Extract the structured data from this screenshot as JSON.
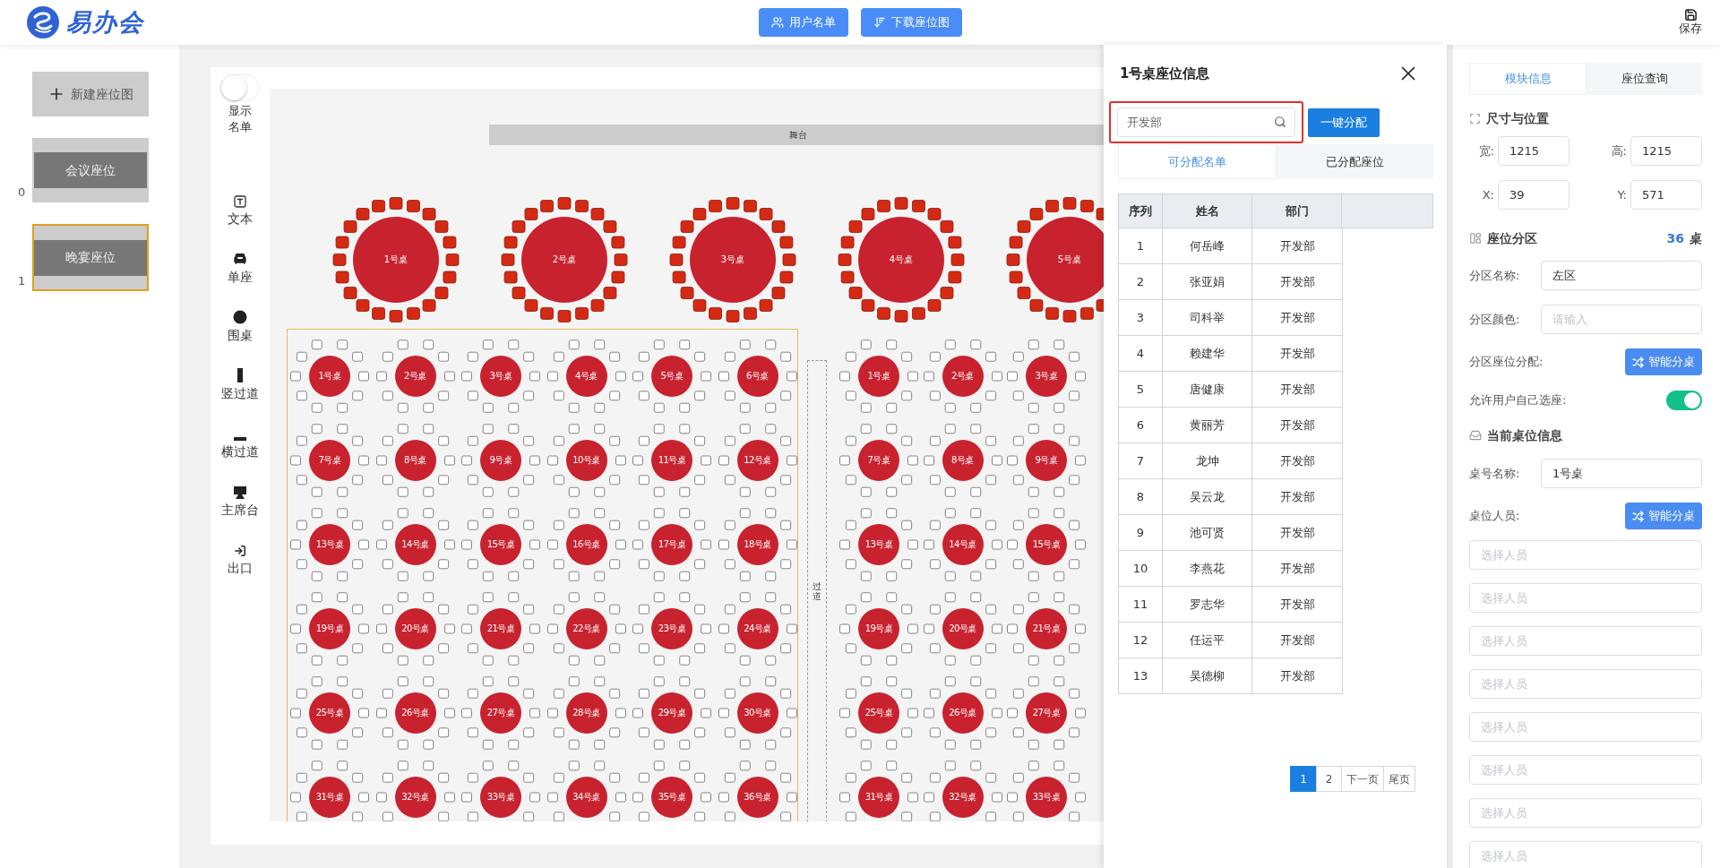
{
  "header": {
    "logo_text": "易办会",
    "buttons": [
      {
        "kind": "users",
        "label": "用户名单"
      },
      {
        "kind": "download",
        "label": "下载座位图"
      }
    ],
    "save": "保存"
  },
  "plans": {
    "new_button": "新建座位图",
    "items": [
      {
        "index": "0",
        "name": "会议座位",
        "selected": false
      },
      {
        "index": "1",
        "name": "晚宴座位",
        "selected": true
      }
    ]
  },
  "tools": {
    "show_list": {
      "label": "显示名单",
      "on": false
    },
    "items": [
      {
        "kind": "text",
        "label": "文本"
      },
      {
        "kind": "seat",
        "label": "单座"
      },
      {
        "kind": "round",
        "label": "围桌"
      },
      {
        "kind": "vaisle",
        "label": "竖过道"
      },
      {
        "kind": "haisle",
        "label": "横过道"
      },
      {
        "kind": "podium",
        "label": "主席台"
      },
      {
        "kind": "exit",
        "label": "出口"
      }
    ]
  },
  "canvas": {
    "stage": "舞台",
    "aisle": "过道",
    "head_tables": [
      "1号桌",
      "2号桌",
      "3号桌",
      "4号桌",
      "5号桌"
    ],
    "zones": [
      {
        "selected": true,
        "tables": [
          "1号桌",
          "2号桌",
          "3号桌",
          "4号桌",
          "5号桌",
          "6号桌",
          "7号桌",
          "8号桌",
          "9号桌",
          "10号桌",
          "11号桌",
          "12号桌",
          "13号桌",
          "14号桌",
          "15号桌",
          "16号桌",
          "17号桌",
          "18号桌",
          "19号桌",
          "20号桌",
          "21号桌",
          "22号桌",
          "23号桌",
          "24号桌",
          "25号桌",
          "26号桌",
          "27号桌",
          "28号桌",
          "29号桌",
          "30号桌",
          "31号桌",
          "32号桌",
          "33号桌",
          "34号桌",
          "35号桌",
          "36号桌"
        ]
      },
      {
        "selected": false,
        "tables": [
          "1号桌",
          "2号桌",
          "3号桌",
          "7号桌",
          "8号桌",
          "9号桌",
          "13号桌",
          "14号桌",
          "15号桌",
          "19号桌",
          "20号桌",
          "21号桌",
          "25号桌",
          "26号桌",
          "27号桌",
          "31号桌",
          "32号桌",
          "33号桌"
        ]
      }
    ]
  },
  "seat_dialog": {
    "title": "1号桌座位信息",
    "search_value": "开发部",
    "assign_button": "一键分配",
    "tabs": [
      {
        "label": "可分配名单",
        "selected": true
      },
      {
        "label": "已分配座位",
        "selected": false
      }
    ],
    "columns": [
      "序列",
      "姓名",
      "部门"
    ],
    "rows": [
      [
        "1",
        "何岳峰",
        "开发部"
      ],
      [
        "2",
        "张亚娟",
        "开发部"
      ],
      [
        "3",
        "司科举",
        "开发部"
      ],
      [
        "4",
        "赖建华",
        "开发部"
      ],
      [
        "5",
        "唐健康",
        "开发部"
      ],
      [
        "6",
        "黄丽芳",
        "开发部"
      ],
      [
        "7",
        "龙坤",
        "开发部"
      ],
      [
        "8",
        "吴云龙",
        "开发部"
      ],
      [
        "9",
        "池可贤",
        "开发部"
      ],
      [
        "10",
        "李燕花",
        "开发部"
      ],
      [
        "11",
        "罗志华",
        "开发部"
      ],
      [
        "12",
        "任运平",
        "开发部"
      ],
      [
        "13",
        "吴德柳",
        "开发部"
      ]
    ],
    "pages": [
      {
        "label": "1",
        "selected": true
      },
      {
        "label": "2",
        "selected": false
      },
      {
        "label": "下一页",
        "selected": false
      },
      {
        "label": "尾页",
        "selected": false
      }
    ]
  },
  "inspector": {
    "tabs": [
      {
        "label": "模块信息",
        "selected": true
      },
      {
        "label": "座位查询",
        "selected": false
      }
    ],
    "size_title": "尺寸与位置",
    "size_fields": [
      {
        "label": "宽:",
        "value": "1215"
      },
      {
        "label": "高:",
        "value": "1215"
      },
      {
        "label": "X:",
        "value": "39"
      },
      {
        "label": "Y:",
        "value": "571"
      }
    ],
    "zone_title": "座位分区",
    "zone_count": "36",
    "zone_unit": "桌",
    "zone_name": {
      "label": "分区名称:",
      "value": "左区"
    },
    "zone_color": {
      "label": "分区颜色:",
      "placeholder": "请输入"
    },
    "zone_assign": {
      "label": "分区座位分配:",
      "button": "智能分桌"
    },
    "self_select": {
      "label": "允许用户自己选座:",
      "on": true
    },
    "table_title": "当前桌位信息",
    "table_name": {
      "label": "桌号名称:",
      "value": "1号桌"
    },
    "table_people": {
      "label": "桌位人员:",
      "button": "智能分桌"
    },
    "person_slots": [
      {
        "placeholder": "选择人员"
      },
      {
        "placeholder": "选择人员"
      },
      {
        "placeholder": "选择人员"
      },
      {
        "placeholder": "选择人员"
      },
      {
        "placeholder": "选择人员"
      },
      {
        "placeholder": "选择人员"
      },
      {
        "placeholder": "选择人员"
      },
      {
        "placeholder": "选择人员"
      }
    ]
  }
}
